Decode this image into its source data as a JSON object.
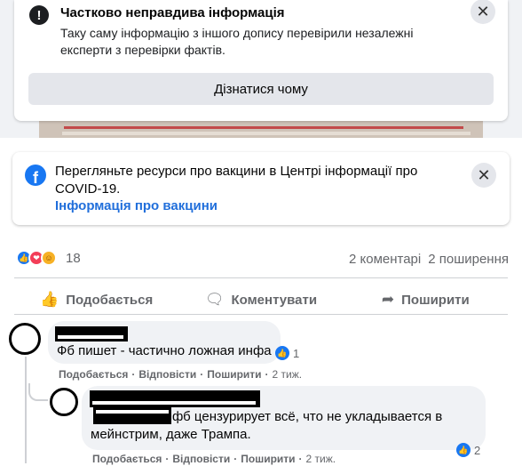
{
  "falsy": {
    "icon": "!",
    "title": "Частково неправдива інформація",
    "text": "Таку саму інформацію з іншого допису перевірили незалежні експерти з перевірки фактів.",
    "button": "Дізнатися чому",
    "close": "✕"
  },
  "covid": {
    "logo": "f",
    "text": "Перегляньте ресурси про вакцини в Центрі інформації про COVID-19.",
    "link": "Інформація про вакцини",
    "close": "✕"
  },
  "reactions": {
    "count": "18",
    "comments": "2 коментарі",
    "shares": "2 поширення"
  },
  "actions": {
    "like": "Подобається",
    "comment": "Коментувати",
    "share": "Поширити"
  },
  "comments": [
    {
      "text": "Фб пишет - частично ложная инфа",
      "likes": "1",
      "like": "Подобається",
      "reply": "Відповісти",
      "share": "Поширити",
      "time": "2 тиж."
    },
    {
      "text_line1": "фб цензурирует всё, что не укладывается в",
      "text_line2": "мейнстрим, даже Трампа.",
      "likes": "2",
      "like": "Подобається",
      "reply": "Відповісти",
      "share": "Поширити",
      "time": "2 тиж."
    }
  ],
  "colors": {
    "link": "#216fdb",
    "like_blue": "#1877f2",
    "muted": "#65676b"
  }
}
